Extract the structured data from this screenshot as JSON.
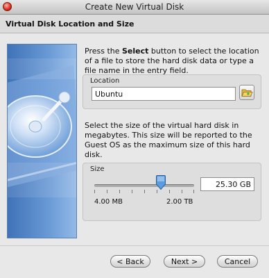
{
  "window": {
    "title": "Create New Virtual Disk"
  },
  "header": {
    "title": "Virtual Disk Location and Size"
  },
  "location": {
    "description_parts": [
      "Press the ",
      "Select",
      " button to select the location of a file to store the hard disk data or type a file name in the entry field."
    ],
    "legend": "Location",
    "value": "Ubuntu",
    "browse_icon": "folder-open-icon"
  },
  "size": {
    "description": "Select the size of the virtual hard disk in megabytes. This size will be reported to the Guest OS as the maximum size of this hard disk.",
    "legend": "Size",
    "value": "25.30 GB",
    "slider_position": 0.67,
    "min_label": "4.00 MB",
    "max_label": "2.00 TB"
  },
  "buttons": {
    "back": "< Back",
    "next": "Next >",
    "cancel": "Cancel"
  },
  "colors": {
    "art_blue": "#4a7cc2",
    "thumb_blue": "#5b9be0"
  }
}
